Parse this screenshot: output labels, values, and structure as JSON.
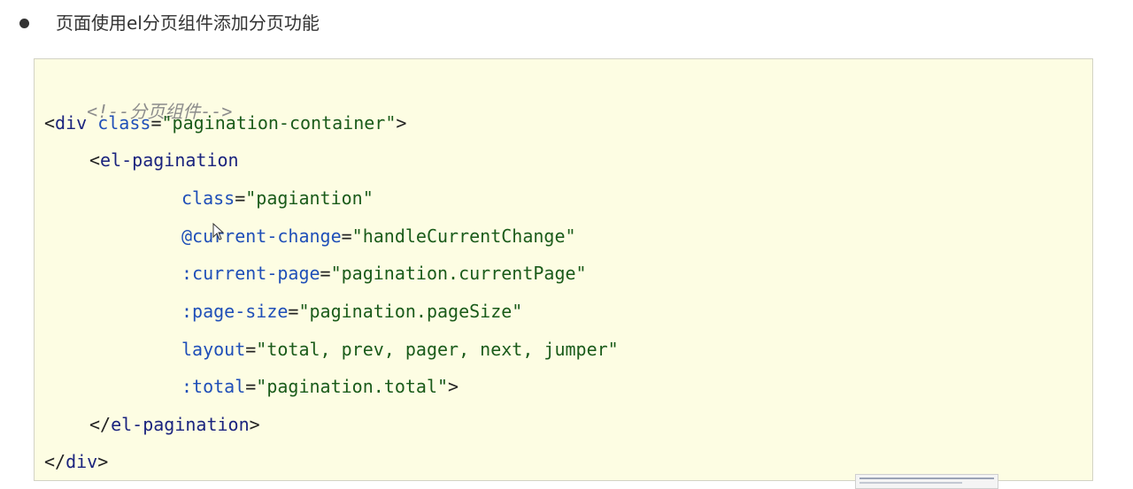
{
  "bullet": {
    "text": "页面使用el分页组件添加分页功能"
  },
  "code": {
    "comment": "<!--分页组件-->",
    "div_open": {
      "lt": "<",
      "tag": "div",
      "attr": "class",
      "eq": "=",
      "value": "\"pagination-container\"",
      "gt": ">"
    },
    "pagination_open": {
      "lt": "<",
      "tag": "el-pagination"
    },
    "attrs": [
      {
        "name": "class",
        "eq": "=",
        "value": "\"pagiantion\""
      },
      {
        "name": "@current-change",
        "eq": "=",
        "value": "\"handleCurrentChange\""
      },
      {
        "name": ":current-page",
        "eq": "=",
        "value": "\"pagination.currentPage\""
      },
      {
        "name": ":page-size",
        "eq": "=",
        "value": "\"pagination.pageSize\""
      },
      {
        "name": "layout",
        "eq": "=",
        "value": "\"total, prev, pager, next, jumper\""
      },
      {
        "name": ":total",
        "eq": "=",
        "value": "\"pagination.total\"",
        "end": ">"
      }
    ],
    "pagination_close": {
      "lt": "</",
      "tag": "el-pagination",
      "gt": ">"
    },
    "div_close": {
      "lt": "</",
      "tag": "div",
      "gt": ">"
    }
  }
}
